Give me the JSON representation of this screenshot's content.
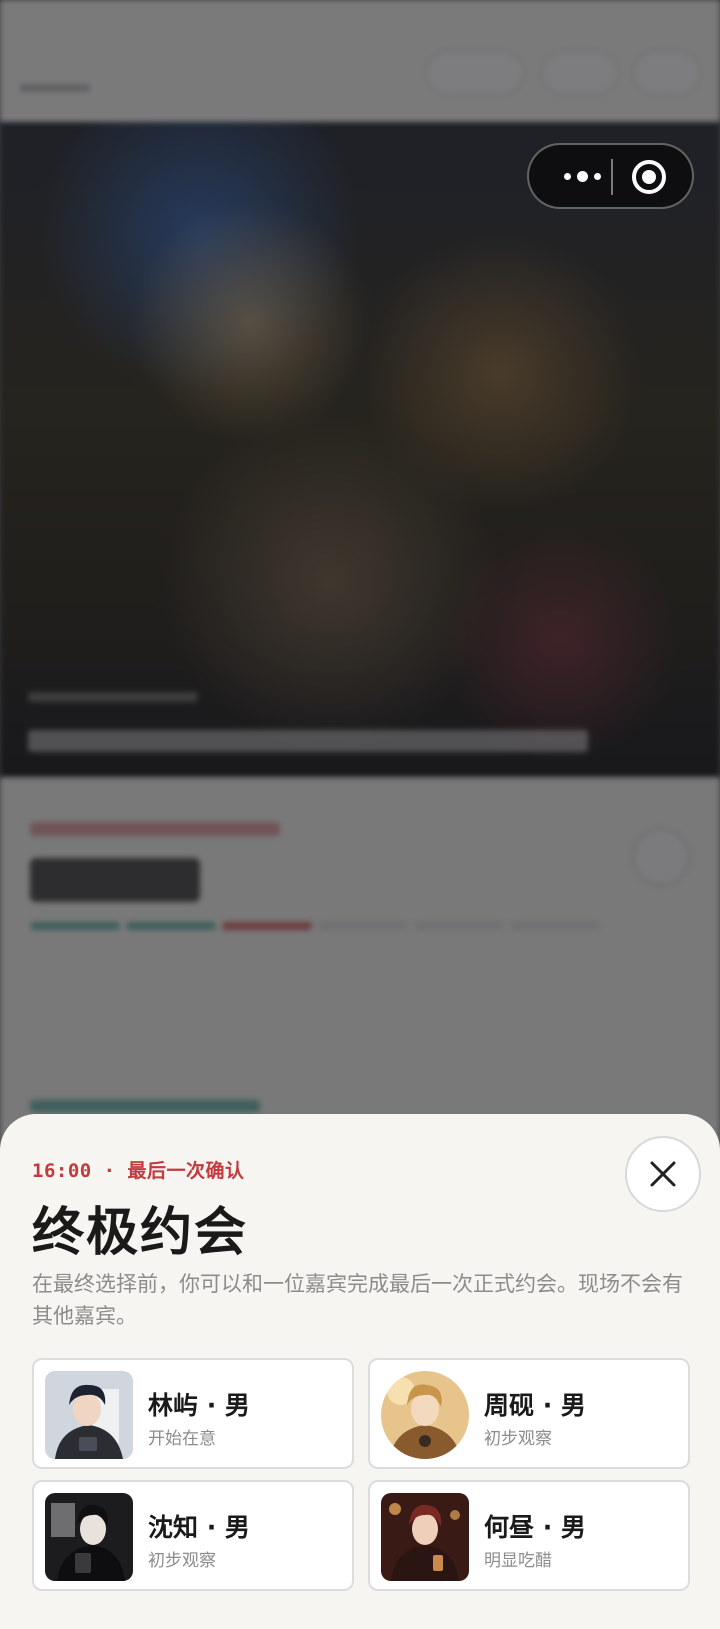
{
  "sheet": {
    "kicker": "16:00 · 最后一次确认",
    "title": "终极约会",
    "description": "在最终选择前，你可以和一位嘉宾完成最后一次正式约会。现场不会有其他嘉宾。",
    "close_icon": "close-icon"
  },
  "guests": [
    {
      "name": "林屿 · 男",
      "status": "开始在意",
      "avatar_style": "dark suit, dark hair"
    },
    {
      "name": "周砚 · 男",
      "status": "初步观察",
      "avatar_style": "golden hair, warm tones"
    },
    {
      "name": "沈知 · 男",
      "status": "初步观察",
      "avatar_style": "black coat, monochrome"
    },
    {
      "name": "何昼 · 男",
      "status": "明显吃醋",
      "avatar_style": "auburn hair, warm bar"
    }
  ],
  "capsule": {
    "more_icon": "more-dots-icon",
    "close_icon": "target-close-icon"
  },
  "colors": {
    "accent_red": "#c23a3e",
    "sheet_bg": "#f6f5f2",
    "overlay": "rgba(22,22,26,0.55)"
  }
}
